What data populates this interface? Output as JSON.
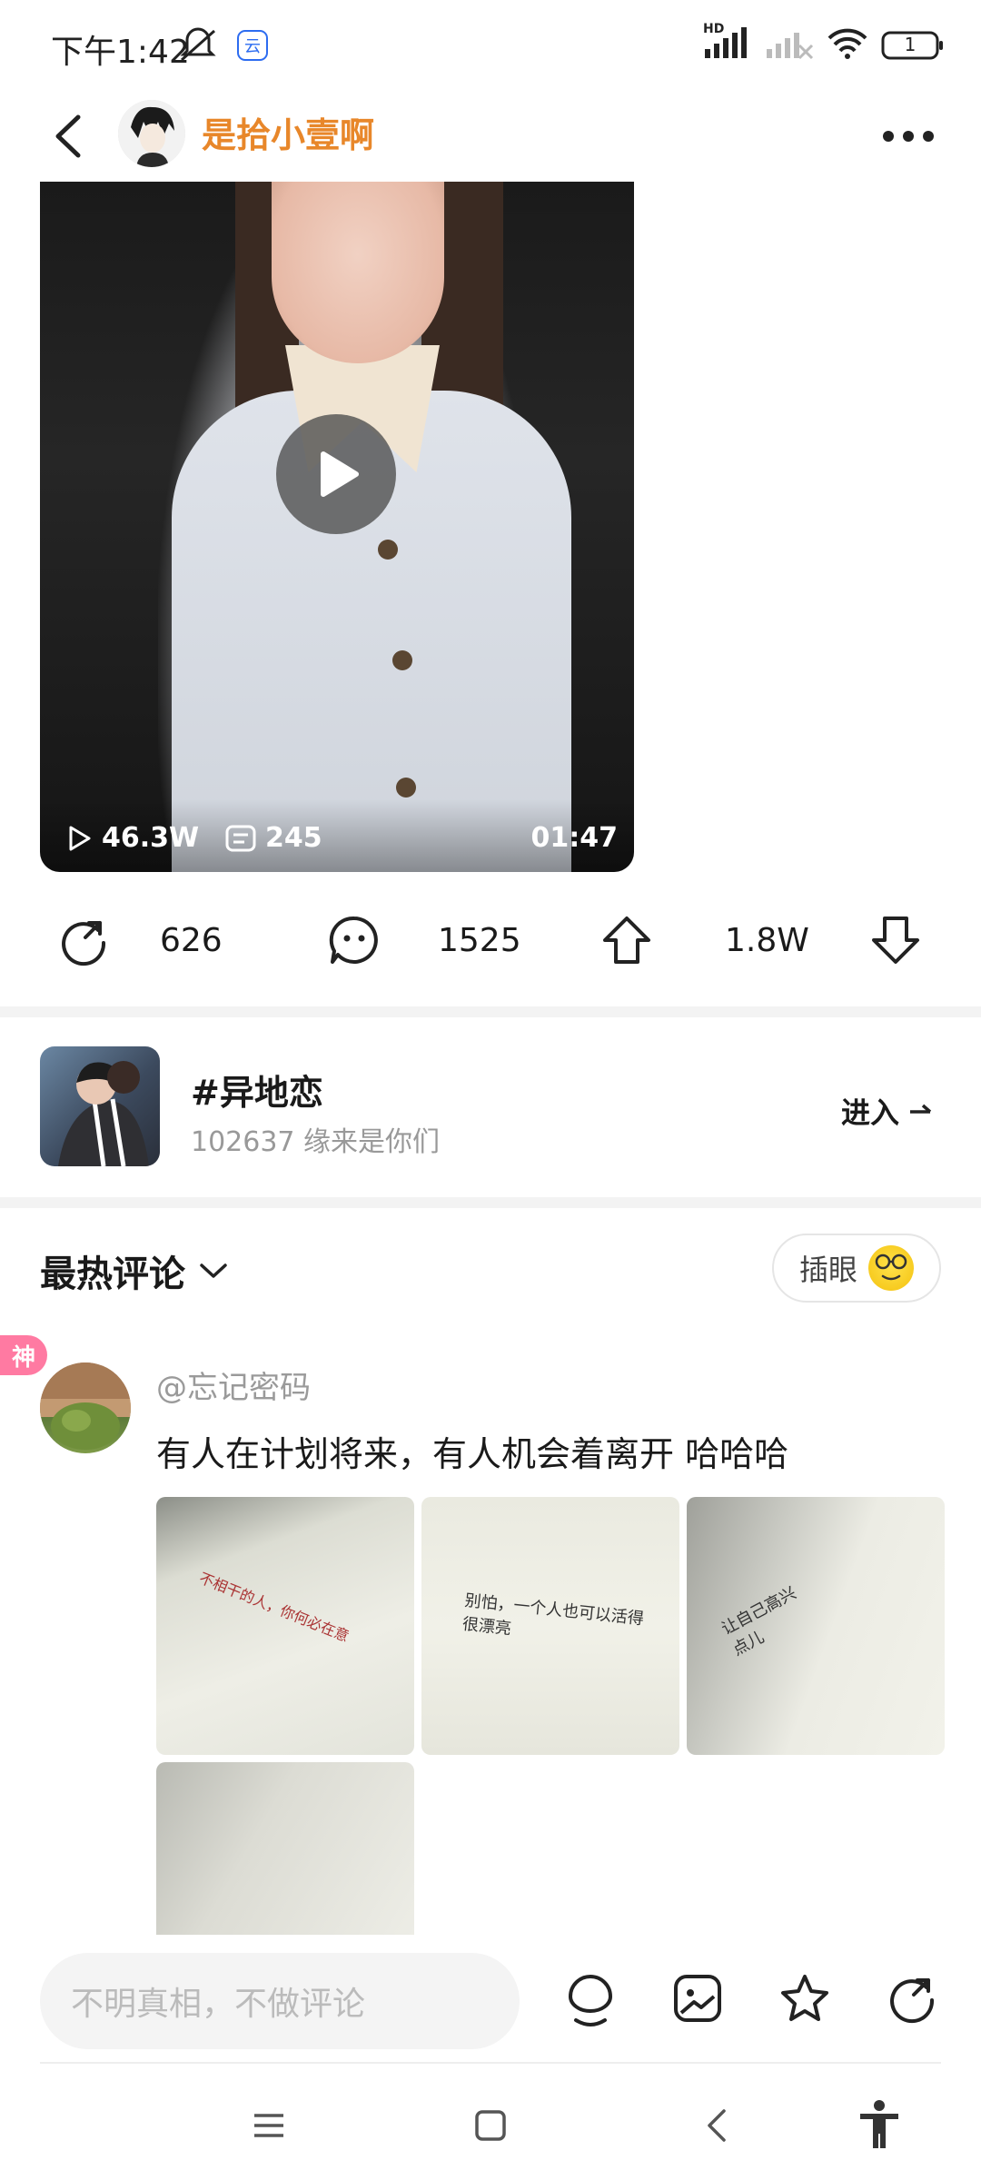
{
  "status_bar": {
    "time": "下午1:42",
    "battery": "1",
    "network_label": "HD"
  },
  "header": {
    "username": "是拾小壹啊",
    "username_color": "#e8872a"
  },
  "video": {
    "views": "46.3W",
    "danmaku": "245",
    "duration": "01:47"
  },
  "actions": {
    "share_count": "626",
    "comment_count": "1525",
    "upvote_count": "1.8W"
  },
  "topic": {
    "name": "#异地恋",
    "subtitle": "102637 缘来是你们",
    "enter_label": "进入"
  },
  "comments": {
    "section_title": "最热评论",
    "insert_label": "插眼",
    "god_badge": "神",
    "items": [
      {
        "user": "@忘记密码",
        "text": "有人在计划将来，有人机会着离开  哈哈哈",
        "images": [
          {
            "caption": "不相干的人，你何必在意"
          },
          {
            "caption": "别怕，一个人也可以活得很漂亮"
          },
          {
            "caption": "让自己高兴点儿"
          },
          {
            "caption": ""
          }
        ]
      }
    ]
  },
  "bottom_bar": {
    "input_placeholder": "不明真相，不做评论"
  },
  "icons": [
    "back-icon",
    "more-icon",
    "play-icon",
    "views-icon",
    "danmaku-icon",
    "share-icon",
    "comment-icon",
    "upvote-icon",
    "downvote-icon",
    "chevron-down-icon",
    "arrow-right-icon",
    "mic-icon",
    "image-icon",
    "star-icon",
    "refresh-share-icon",
    "menu-icon",
    "home-icon",
    "nav-back-icon",
    "accessibility-icon"
  ]
}
